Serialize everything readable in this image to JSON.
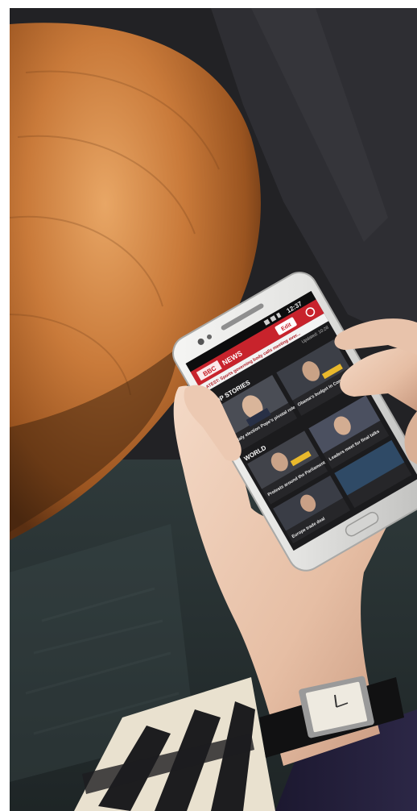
{
  "photo": {
    "subject": "hand holding smartphone showing news app",
    "phone_screen": {
      "status_bar": {
        "time": "12:37"
      },
      "app": {
        "title_left": "BBC",
        "title_right": "NEWS",
        "buttons": [
          "Edit"
        ],
        "updated_text": "Updated: 10:28",
        "ticker_text": "LATEST: Sports governing body calls meeting over...",
        "sections": [
          {
            "name": "TOP STORIES",
            "headlines": [
              "Italy election Pope's pivotal role",
              "Obama's budget in Congress"
            ]
          },
          {
            "name": "WORLD",
            "headlines": [
              "Protests around the Parliament",
              "Leaders meet for final talks",
              "Europe trade deal"
            ]
          }
        ]
      },
      "colors": {
        "header_red": "#c8232c",
        "screen_bg": "#1b1b1d",
        "card_dark": "#262629"
      }
    },
    "watch": {
      "face_color": "#eeeae0"
    },
    "icons": [
      "wifi-icon",
      "signal-icon",
      "battery-icon",
      "refresh-icon",
      "home-button-icon"
    ]
  }
}
